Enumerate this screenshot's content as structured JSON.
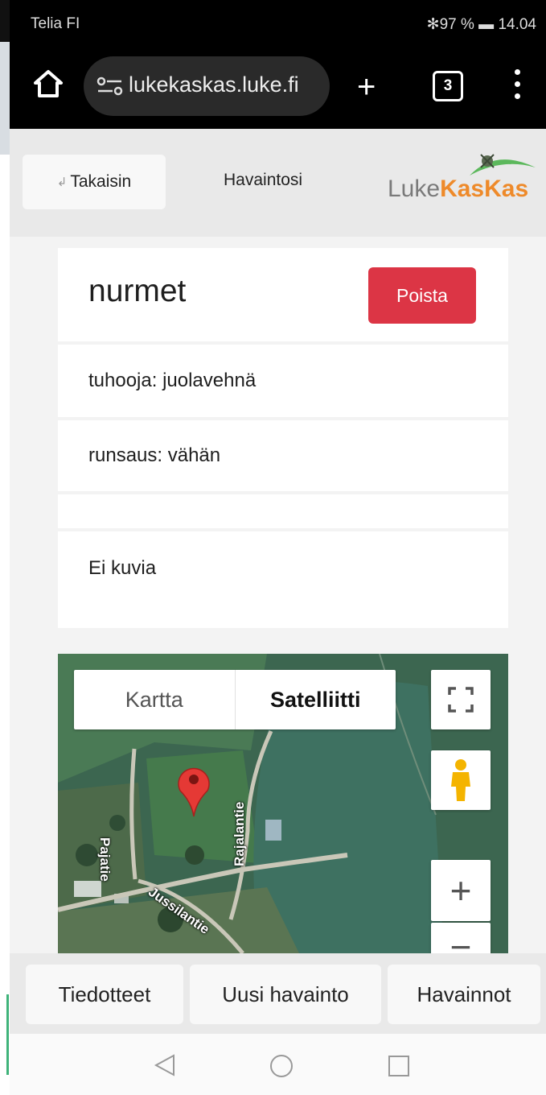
{
  "status_bar": {
    "carrier": "Telia FI",
    "indicators": "✻97 % ▬ 14.04"
  },
  "browser": {
    "url": "lukekaskas.luke.fi",
    "tab_count": "3"
  },
  "app_header": {
    "back_label": "Takaisin",
    "nav_observations": "Havaintosi",
    "logo_part1": "Luke",
    "logo_part2": "KasKas"
  },
  "observation": {
    "title": "nurmet",
    "delete_label": "Poista",
    "pest": "tuhooja: juolavehnä",
    "abundance": "runsaus: vähän",
    "no_images": "Ei kuvia"
  },
  "map": {
    "type_map": "Kartta",
    "type_satellite": "Satelliitti",
    "roads": [
      "Pajatie",
      "Rajalantie",
      "Jussilantie"
    ]
  },
  "bottom_nav": {
    "bulletins": "Tiedotteet",
    "new_observation": "Uusi havainto",
    "observations": "Havainnot"
  },
  "colors": {
    "delete": "#dc3545",
    "logo_gray": "#7a7a7a",
    "logo_orange": "#ee8a2a",
    "map_pin": "#e53935"
  }
}
